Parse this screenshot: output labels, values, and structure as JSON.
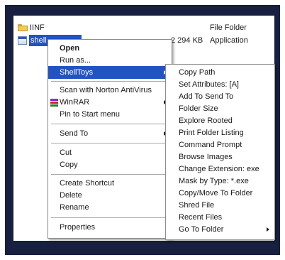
{
  "files": [
    {
      "name": "IINF",
      "size": "",
      "type": "File Folder",
      "icon": "folder-icon"
    },
    {
      "name": "shell",
      "size": "2 294 KB",
      "type": "Application",
      "icon": "app-icon",
      "selected": true
    }
  ],
  "context_menu": {
    "items": [
      {
        "label": "Open",
        "bold": true
      },
      {
        "label": "Run as..."
      },
      {
        "label": "ShellToys",
        "highlighted": true,
        "submenu": true
      },
      {
        "label": "Scan with Norton AntiVirus"
      },
      {
        "label": "WinRAR",
        "submenu": true,
        "icon": "winrar-icon"
      },
      {
        "label": "Pin to Start menu"
      },
      {
        "label": "Send To",
        "submenu": true
      },
      {
        "label": "Cut"
      },
      {
        "label": "Copy"
      },
      {
        "label": "Create Shortcut"
      },
      {
        "label": "Delete"
      },
      {
        "label": "Rename"
      },
      {
        "label": "Properties"
      }
    ]
  },
  "submenu": {
    "items": [
      {
        "label": "Copy Path"
      },
      {
        "label": "Set Attributes: [A]"
      },
      {
        "label": "Add To Send To"
      },
      {
        "label": "Folder Size"
      },
      {
        "label": "Explore Rooted"
      },
      {
        "label": "Print Folder Listing"
      },
      {
        "label": "Command Prompt"
      },
      {
        "label": "Browse Images"
      },
      {
        "label": "Change Extension: exe"
      },
      {
        "label": "Mask by Type: *.exe"
      },
      {
        "label": "Copy/Move To Folder"
      },
      {
        "label": "Shred File"
      },
      {
        "label": "Recent Files"
      },
      {
        "label": "Go To Folder",
        "submenu": true
      }
    ]
  },
  "colors": {
    "frame": "#18203f",
    "highlight": "#2253c2",
    "folder": "#f2c95a"
  }
}
